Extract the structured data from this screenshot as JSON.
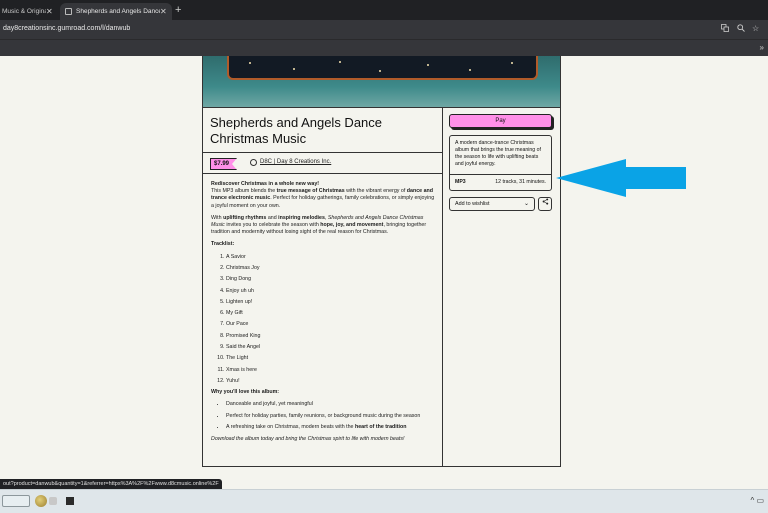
{
  "browser": {
    "tabs": [
      {
        "title": "Music & Origina"
      },
      {
        "title": "Shepherds and Angels Dance C"
      }
    ],
    "new_tab_label": "+",
    "address": "day8creationsinc.gumroad.com/l/danwub",
    "more_label": "»"
  },
  "product": {
    "title": "Shepherds and Angels Dance Christmas Music",
    "price": "$7.99",
    "creator": "D8C | Day 8 Creations Inc.",
    "pay_label": "Pay",
    "summary": "A modern dance-trance Christmas album that brings the true meaning of the season to life with uplifting beats and joyful energy.",
    "format": "MP3",
    "length": "12 tracks, 31 minutes.",
    "wishlist_label": "Add to wishlist"
  },
  "description": {
    "intro_heading": "Rediscover Christmas in a whole new way!",
    "intro_1": "This MP3 album blends the ",
    "intro_1b": "true message of Christmas",
    "intro_1c": " with the vibrant energy of ",
    "intro_1d": "dance and trance electronic music",
    "intro_1e": ". Perfect for holiday gatherings, family celebrations, or simply enjoying a joyful moment on your own.",
    "p2_a": "With ",
    "p2_b": "uplifting rhythms",
    "p2_c": " and ",
    "p2_d": "inspiring melodies",
    "p2_e": ", ",
    "p2_f": "Shepherds and Angels Dance Christmas Music",
    "p2_g": " invites you to celebrate the season with ",
    "p2_h": "hope, joy, and movement",
    "p2_i": ", bringing together tradition and modernity without losing sight of the real reason for Christmas.",
    "tracklist_heading": "Tracklist:",
    "tracks": [
      "A Savior",
      "Christmas Joy",
      "Ding Dong",
      "Enjoy uh uh",
      "Lighten up!",
      "My Gift",
      "Our Pace",
      "Promised King",
      "Said the Angel",
      "The Light",
      "Xmas is here",
      "Yuhu!"
    ],
    "love_heading": "Why you'll love this album:",
    "love_1": "Danceable and joyful, yet meaningful",
    "love_2": "Perfect for holiday parties, family reunions, or background music during the season",
    "love_3a": "A refreshing take on Christmas, modern beats with the ",
    "love_3b": "heart of the tradition",
    "closing": "Download the album today and bring the Christmas spirit to life with modern beats!"
  },
  "status_url": "out?product=danwub&quantity=1&referrer=https%3A%2F%2Fwww.d8cmusic.online%2F",
  "colors": {
    "accent_pink": "#ff90e8",
    "annotation_arrow": "#0aa3e6"
  },
  "icons": [
    "translate-icon",
    "zoom-icon",
    "star-icon",
    "close-icon",
    "creator-icon",
    "share-icon",
    "chevron-down-icon"
  ]
}
